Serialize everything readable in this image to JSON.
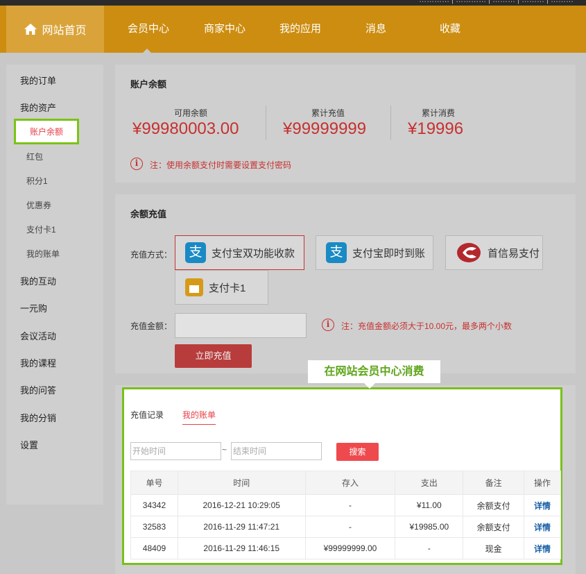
{
  "top_strip": {
    "text": "………… | ………… | ……… | ……… | ………"
  },
  "nav": {
    "home": "网站首页",
    "items": [
      "会员中心",
      "商家中心",
      "我的应用",
      "消息",
      "收藏"
    ]
  },
  "sidebar": {
    "items": [
      "我的订单",
      "我的资产",
      "账户余额",
      "红包",
      "积分1",
      "优惠券",
      "支付卡1",
      "我的账单",
      "我的互动",
      "一元购",
      "会议活动",
      "我的课程",
      "我的问答",
      "我的分销",
      "设置"
    ]
  },
  "balance": {
    "title": "账户余额",
    "available_label": "可用余额",
    "available_value": "¥99980003.00",
    "recharged_label": "累计充值",
    "recharged_value": "¥99999999",
    "spent_label": "累计消费",
    "spent_value": "¥19996",
    "note": "注：使用余额支付时需要设置支付密码"
  },
  "recharge": {
    "title": "余额充值",
    "method_label": "充值方式：",
    "methods": [
      "支付宝双功能收款",
      "支付宝即时到账",
      "首信易支付",
      "支付卡1"
    ],
    "amount_label": "充值金额：",
    "amount_value": "",
    "note": "注：充值金额必须大于10.00元，最多两个小数",
    "submit": "立即充值"
  },
  "callout": "在网站会员中心消费",
  "bill": {
    "tabs": [
      "充值记录",
      "我的账单"
    ],
    "start_placeholder": "开始时间",
    "tilde": "~",
    "end_placeholder": "结束时间",
    "search": "搜索",
    "columns": [
      "单号",
      "时间",
      "存入",
      "支出",
      "备注",
      "操作"
    ],
    "rows": [
      [
        "34342",
        "2016-12-21 10:29:05",
        "-",
        "¥11.00",
        "余额支付",
        "详情"
      ],
      [
        "32583",
        "2016-11-29 11:47:21",
        "-",
        "¥19985.00",
        "余额支付",
        "详情"
      ],
      [
        "48409",
        "2016-11-29 11:46:15",
        "¥99999999.00",
        "-",
        "现金",
        "详情"
      ]
    ]
  },
  "colors": {
    "nav": "#cc8d10",
    "accent_red": "#c7302f",
    "highlight_green": "#7ac414"
  }
}
